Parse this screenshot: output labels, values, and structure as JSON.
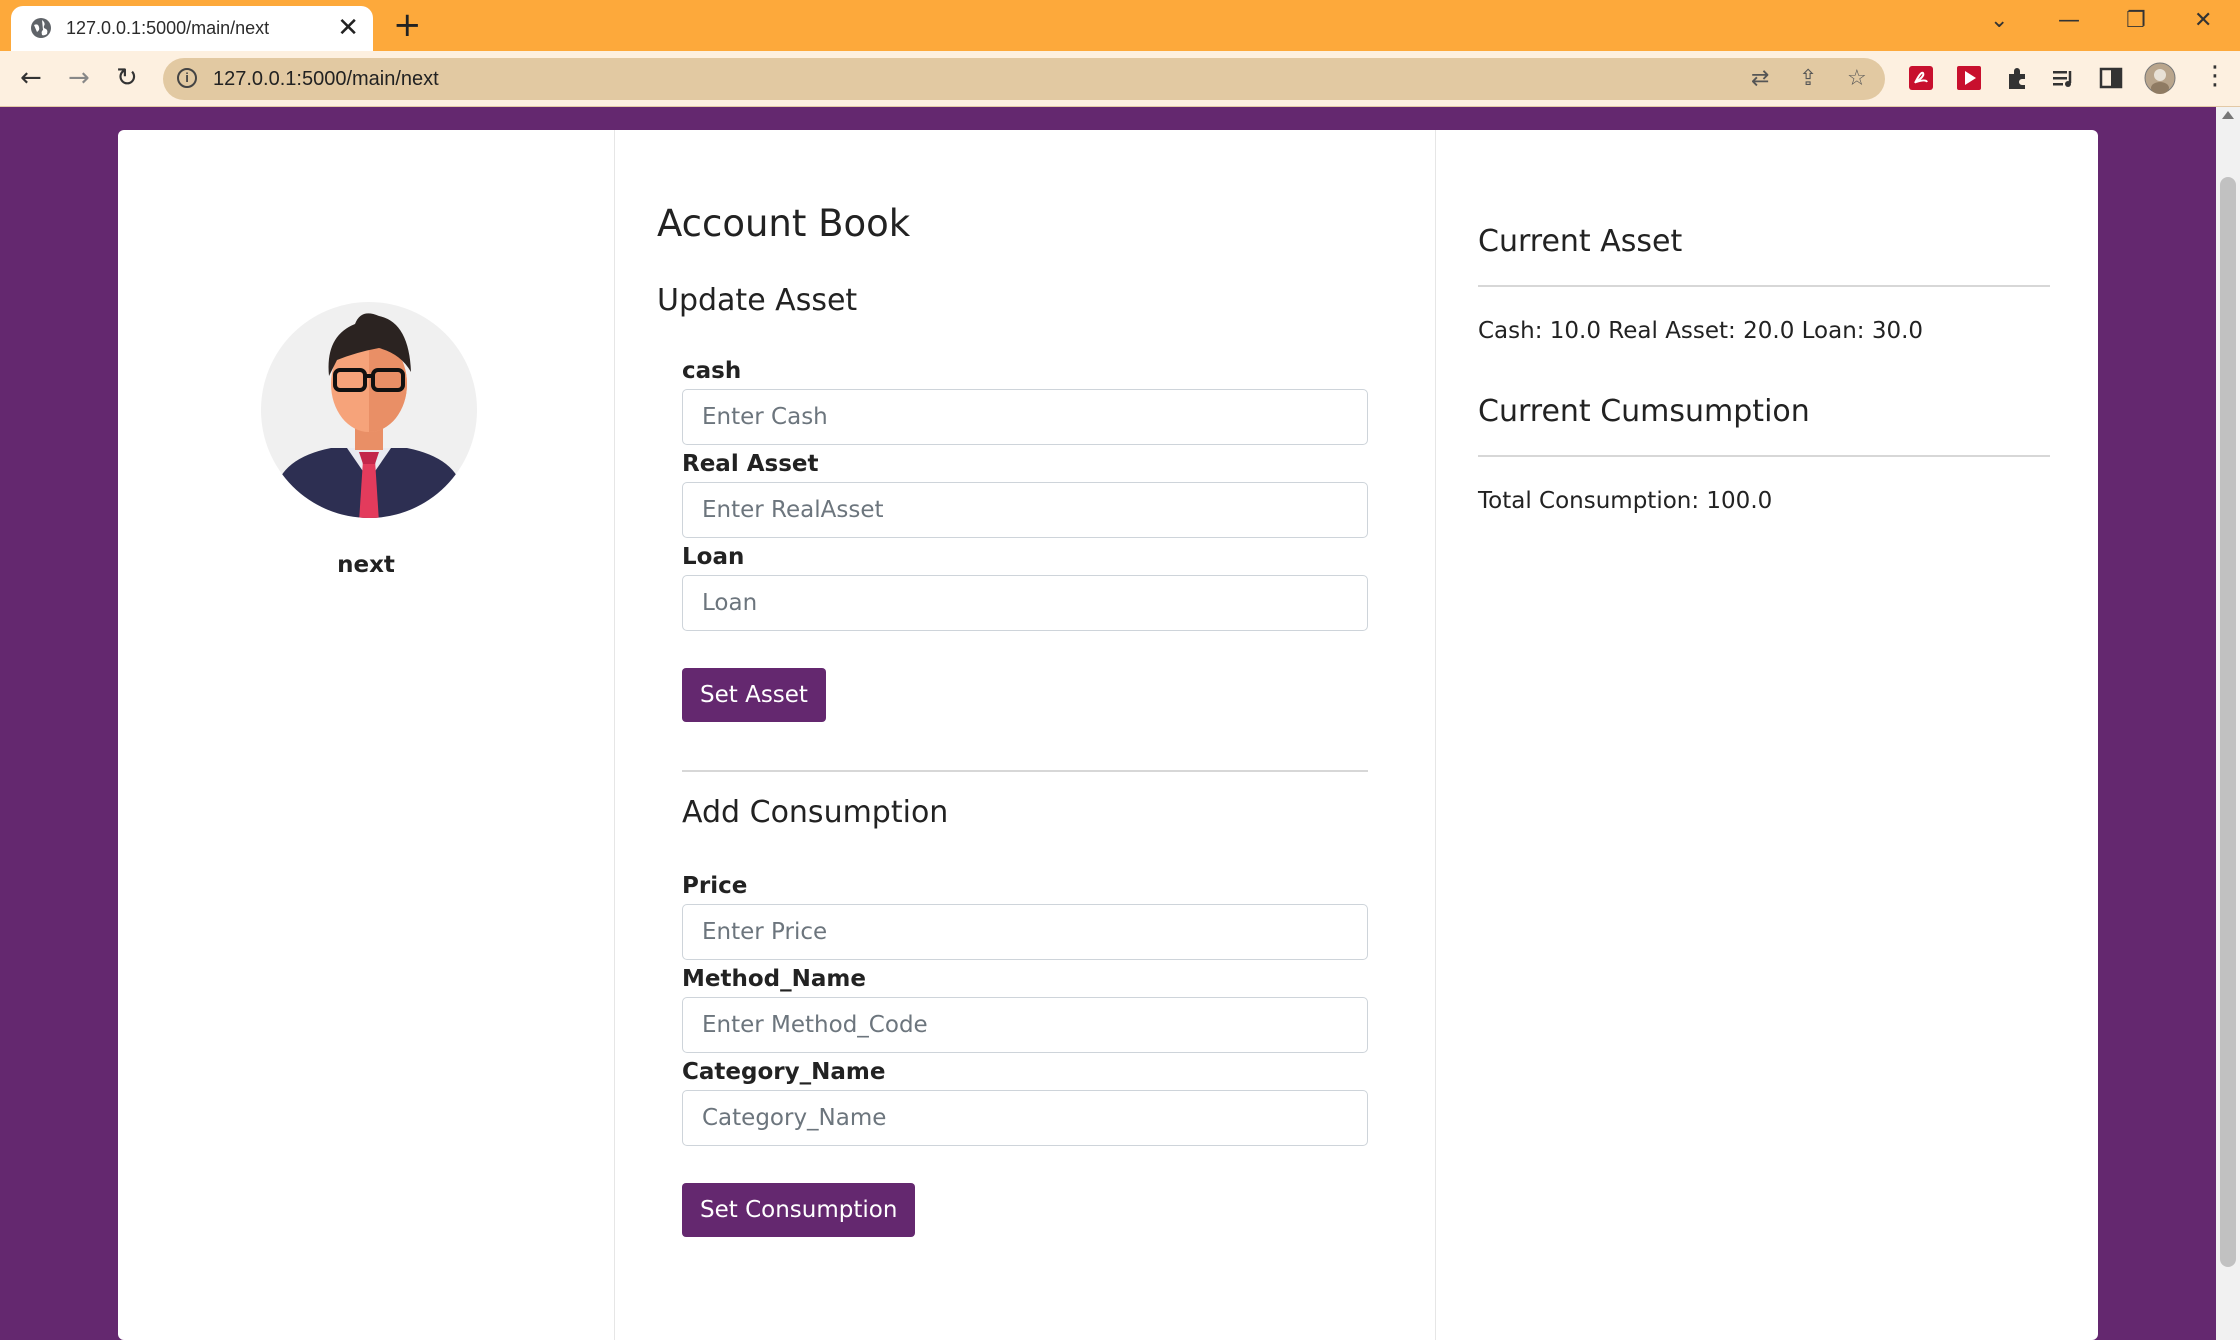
{
  "browser": {
    "tab_title": "127.0.0.1:5000/main/next",
    "url": "127.0.0.1:5000/main/next"
  },
  "sidebar": {
    "username": "next"
  },
  "main": {
    "title": "Account Book",
    "asset_section": {
      "heading": "Update Asset",
      "cash_label": "cash",
      "cash_placeholder": "Enter Cash",
      "real_asset_label": "Real Asset",
      "real_asset_placeholder": "Enter RealAsset",
      "loan_label": "Loan",
      "loan_placeholder": "Loan",
      "submit_label": "Set Asset"
    },
    "consumption_section": {
      "heading": "Add Consumption",
      "price_label": "Price",
      "price_placeholder": "Enter Price",
      "method_label": "Method_Name",
      "method_placeholder": "Enter Method_Code",
      "category_label": "Category_Name",
      "category_placeholder": "Category_Name",
      "submit_label": "Set Consumption"
    }
  },
  "summary": {
    "asset_heading": "Current Asset",
    "asset_text": "Cash: 10.0 Real Asset: 20.0 Loan: 30.0",
    "consumption_heading": "Current Cumsumption",
    "consumption_text": "Total Consumption: 100.0"
  },
  "colors": {
    "brand": "#64286f",
    "tabbar": "#fda93b"
  }
}
